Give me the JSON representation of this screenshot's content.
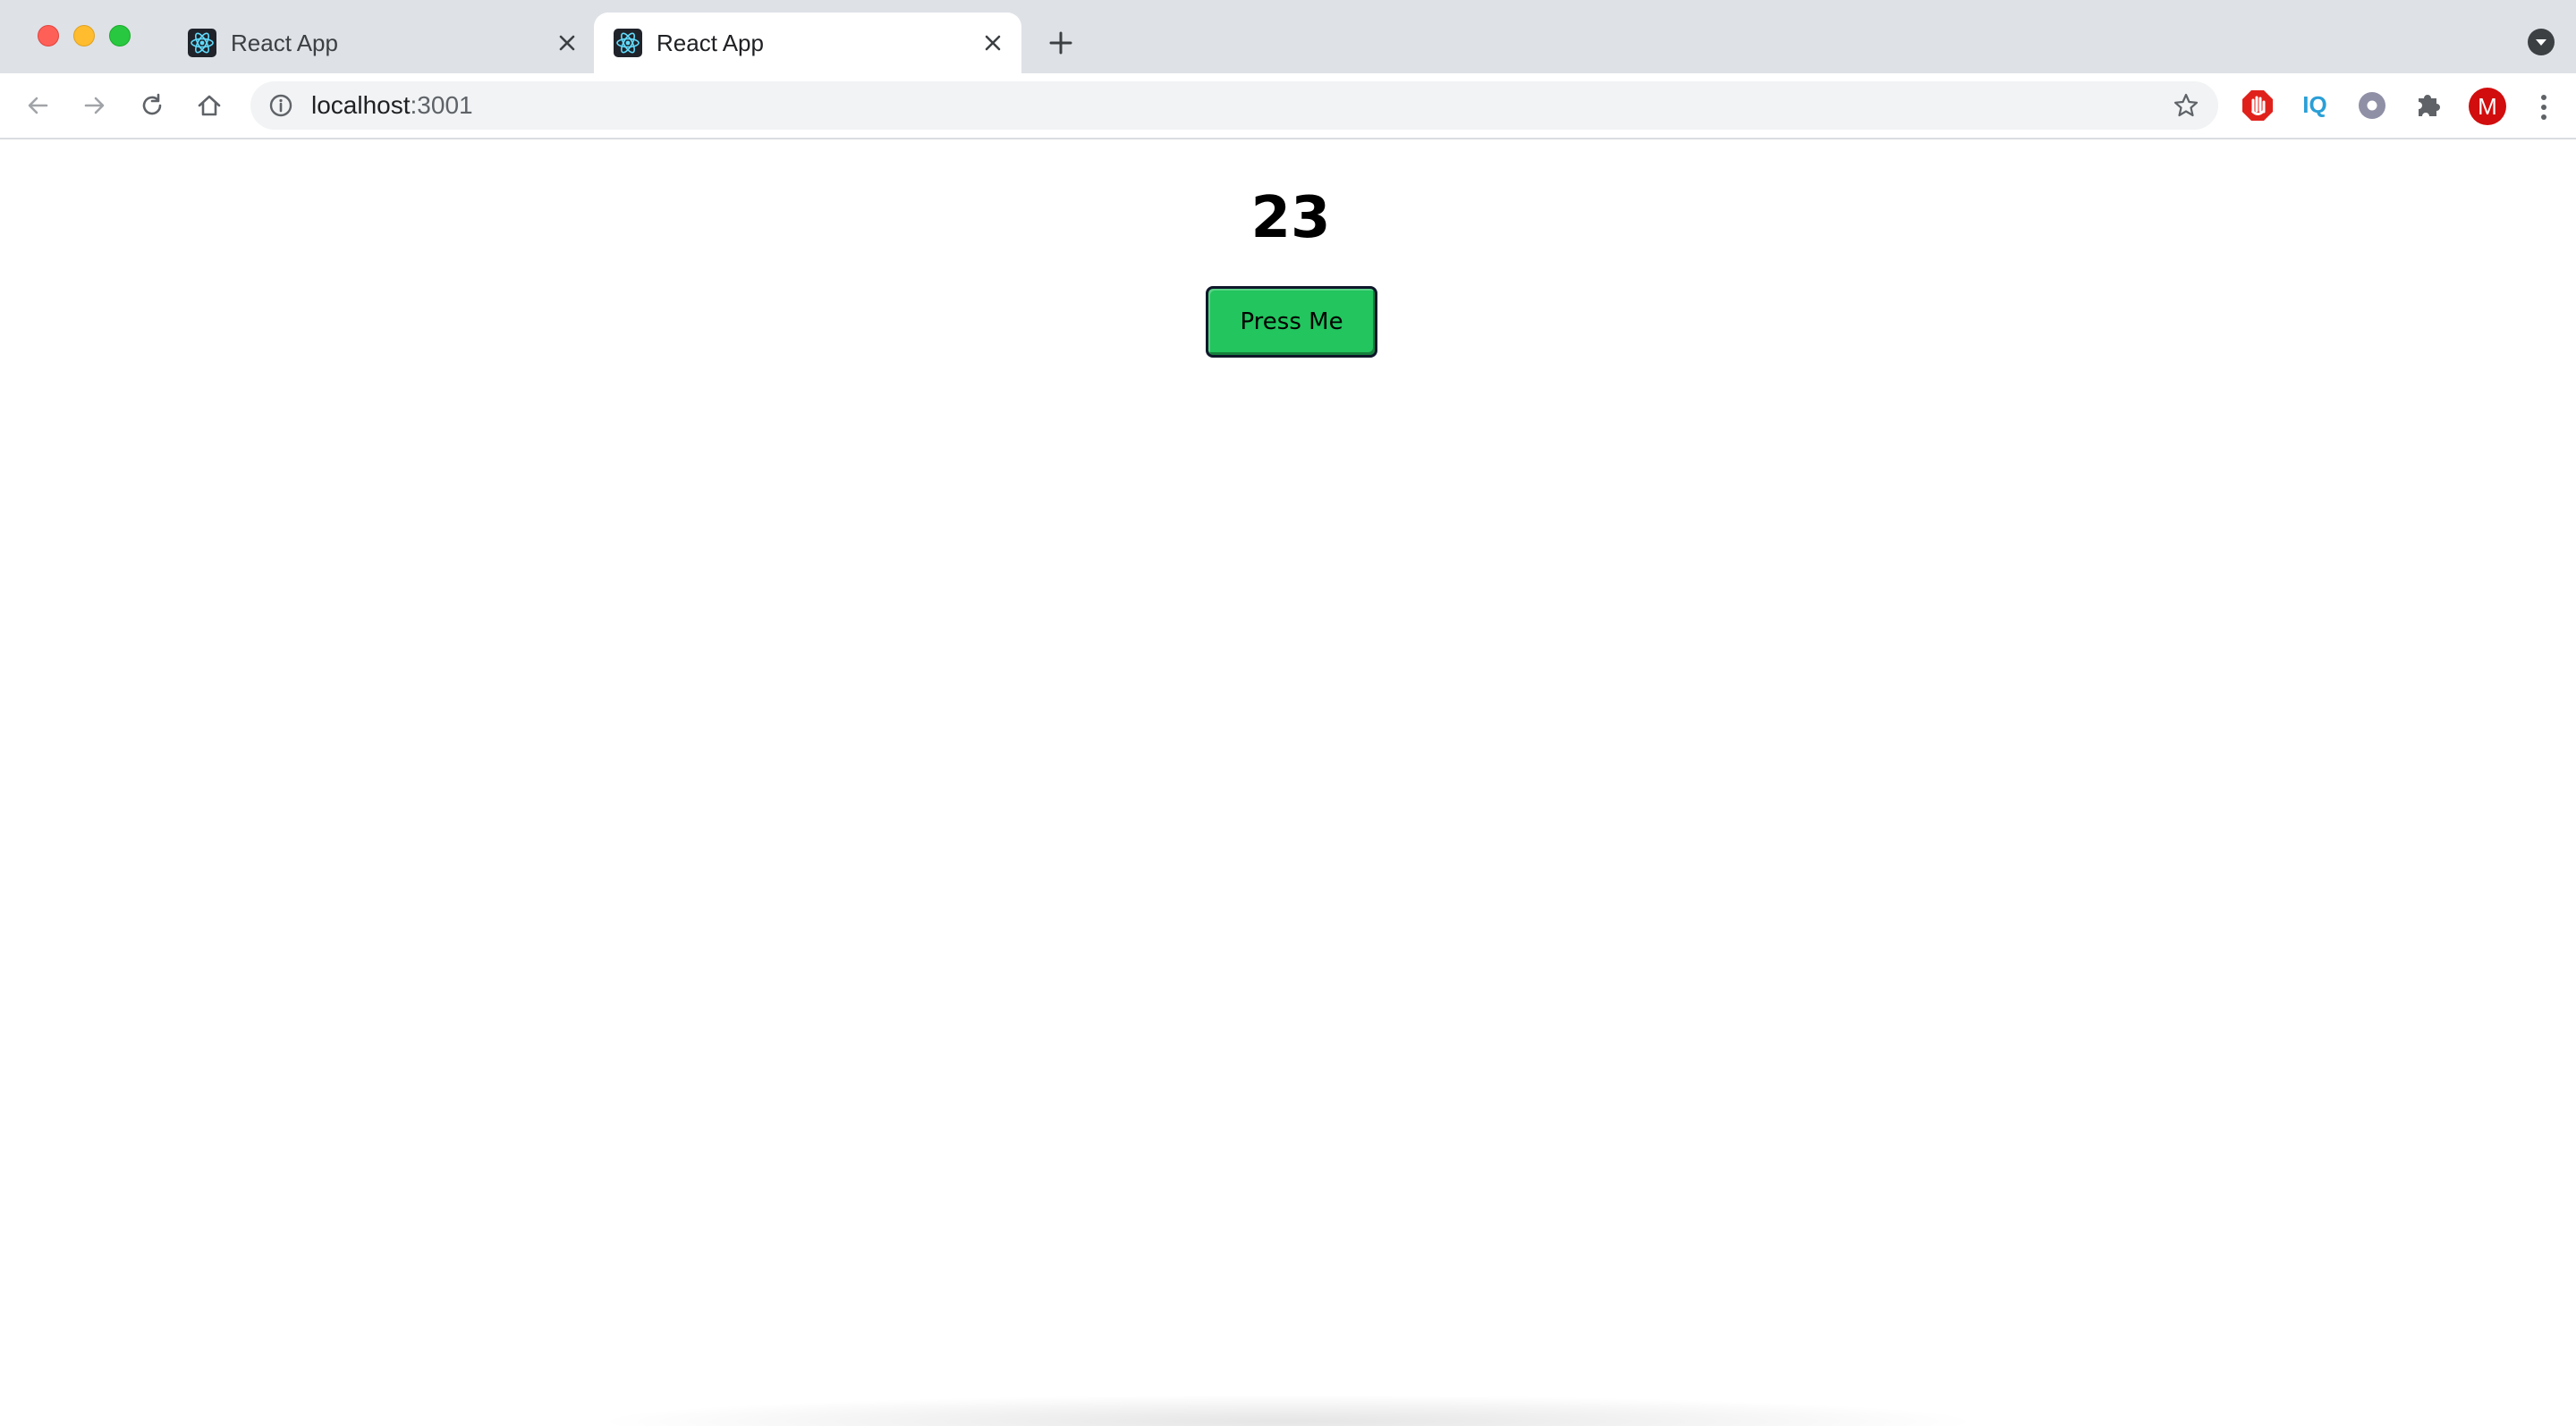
{
  "browser": {
    "tabs": [
      {
        "title": "React App",
        "active": false
      },
      {
        "title": "React App",
        "active": true
      }
    ],
    "address": {
      "host": "localhost",
      "port": ":3001"
    },
    "profile_initial": "M",
    "icons": {
      "traffic_lights": [
        "close",
        "minimize",
        "maximize"
      ],
      "favicon": "react-logo-icon",
      "toolbar": [
        "back-icon",
        "forward-icon",
        "reload-icon",
        "home-icon"
      ],
      "omnibox": [
        "info-icon",
        "star-icon"
      ],
      "extensions": [
        "stop-hand-icon",
        "iq-icon",
        "circle-dot-icon",
        "puzzle-icon"
      ],
      "menu": "more-vert-icon"
    },
    "colors": {
      "tabstrip": "#dee1e6",
      "omnibox": "#f1f3f4",
      "avatar": "#d10d0d"
    }
  },
  "page": {
    "counter": "23",
    "button_label": "Press Me",
    "button_color": "#22c55e"
  }
}
